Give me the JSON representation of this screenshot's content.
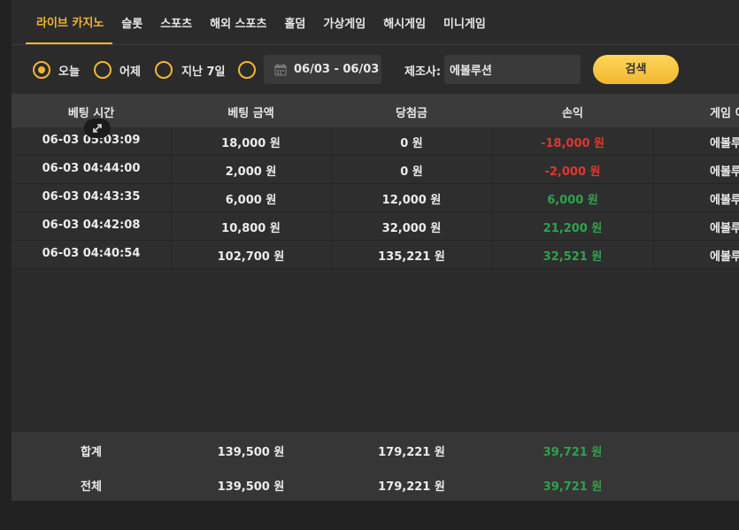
{
  "tabs": [
    {
      "label": "라이브 카지노",
      "active": true
    },
    {
      "label": "슬롯",
      "active": false
    },
    {
      "label": "스포츠",
      "active": false
    },
    {
      "label": "해외 스포츠",
      "active": false
    },
    {
      "label": "홀덤",
      "active": false
    },
    {
      "label": "가상게임",
      "active": false
    },
    {
      "label": "해시게임",
      "active": false
    },
    {
      "label": "미니게임",
      "active": false
    }
  ],
  "filter": {
    "today": "오늘",
    "yesterday": "어제",
    "last7": "지난 7일",
    "date_range": "06/03 - 06/03",
    "maker_label": "제조사:",
    "maker_value": "에볼루션",
    "search": "검색"
  },
  "table": {
    "headers": [
      "베팅 시간",
      "베팅 금액",
      "당첨금",
      "손익",
      "게임 이"
    ],
    "rows": [
      {
        "time": "06-03 05:03:09",
        "bet": "18,000 원",
        "win": "0 원",
        "pl": "-18,000 원",
        "pl_sign": "neg",
        "game": "에볼루"
      },
      {
        "time": "06-03 04:44:00",
        "bet": "2,000 원",
        "win": "0 원",
        "pl": "-2,000 원",
        "pl_sign": "neg",
        "game": "에볼루"
      },
      {
        "time": "06-03 04:43:35",
        "bet": "6,000 원",
        "win": "12,000 원",
        "pl": "6,000 원",
        "pl_sign": "pos",
        "game": "에볼루"
      },
      {
        "time": "06-03 04:42:08",
        "bet": "10,800 원",
        "win": "32,000 원",
        "pl": "21,200 원",
        "pl_sign": "pos",
        "game": "에볼루"
      },
      {
        "time": "06-03 04:40:54",
        "bet": "102,700 원",
        "win": "135,221 원",
        "pl": "32,521 원",
        "pl_sign": "pos",
        "game": "에볼루"
      }
    ]
  },
  "summary": {
    "total_label": "합계",
    "total_bet": "139,500 원",
    "total_win": "179,221 원",
    "total_pl": "39,721 원",
    "all_label": "전체",
    "all_bet": "139,500 원",
    "all_win": "179,221 원",
    "all_pl": "39,721 원"
  },
  "colors": {
    "accent": "#f2b632",
    "negative": "#e0372c",
    "positive": "#2fa24d"
  }
}
